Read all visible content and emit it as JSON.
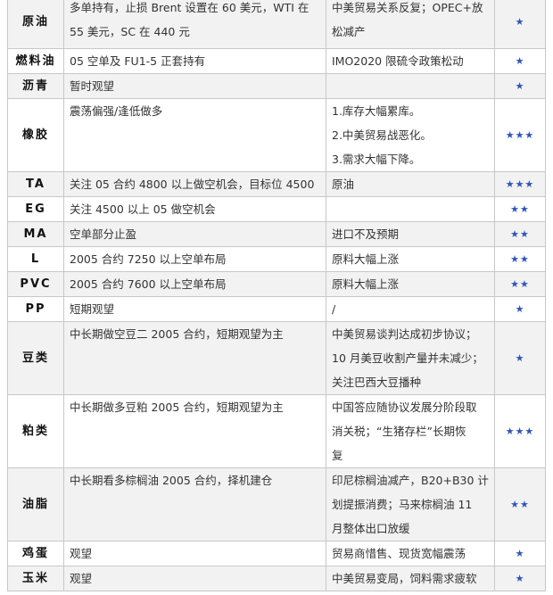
{
  "rows": [
    {
      "name": "原油",
      "strategy": [
        "多单持有，止损 Brent 设置在 60 美元，WTI 在",
        "55 美元，SC 在 440 元"
      ],
      "factors": [
        "中美贸易关系反复；OPEC+放",
        "松减产"
      ],
      "stars": "★",
      "shaded": true
    },
    {
      "name": "燃料油",
      "strategy": [
        "05 空单及 FU1-5 正套持有"
      ],
      "factors": [
        "IMO2020 限硫令政策松动"
      ],
      "stars": "★",
      "shaded": false
    },
    {
      "name": "沥青",
      "strategy": [
        "暂时观望"
      ],
      "factors": [],
      "stars": "★",
      "shaded": true
    },
    {
      "name": "橡胶",
      "strategy": [
        "震荡偏强/逢低做多"
      ],
      "factors": [
        "1.库存大幅累库。",
        "2.中美贸易战恶化。",
        "3.需求大幅下降。"
      ],
      "stars": "★★★",
      "shaded": false
    },
    {
      "name": "TA",
      "strategy": [
        "关注 05 合约 4800 以上做空机会，目标位 4500"
      ],
      "factors": [
        "原油"
      ],
      "stars": "★★★",
      "shaded": true
    },
    {
      "name": "EG",
      "strategy": [
        "关注 4500 以上 05 做空机会"
      ],
      "factors": [],
      "stars": "★★",
      "shaded": false
    },
    {
      "name": "MA",
      "strategy": [
        "空单部分止盈"
      ],
      "factors": [
        "进口不及预期"
      ],
      "stars": "★★",
      "shaded": true
    },
    {
      "name": "L",
      "strategy": [
        "2005 合约 7250 以上空单布局"
      ],
      "factors": [
        "原料大幅上涨"
      ],
      "stars": "★★",
      "shaded": false
    },
    {
      "name": "PVC",
      "strategy": [
        "2005 合约 7600 以上空单布局"
      ],
      "factors": [
        "原料大幅上涨"
      ],
      "stars": "★★",
      "shaded": true
    },
    {
      "name": "PP",
      "strategy": [
        "短期观望"
      ],
      "factors": [
        "/"
      ],
      "stars": "★",
      "shaded": false
    },
    {
      "name": "豆类",
      "strategy": [
        "中长期做空豆二 2005 合约，短期观望为主"
      ],
      "factors": [
        "中美贸易谈判达成初步协议；",
        "10 月美豆收割产量并未减少；",
        "关注巴西大豆播种"
      ],
      "stars": "★",
      "shaded": true
    },
    {
      "name": "粕类",
      "strategy": [
        "中长期做多豆粕 2005 合约，短期观望为主"
      ],
      "factors": [
        "中国答应随协议发展分阶段取",
        "消关税；“生猪存栏”长期恢",
        "复"
      ],
      "stars": "★★★",
      "shaded": false
    },
    {
      "name": "油脂",
      "strategy": [
        "中长期看多棕榈油 2005 合约，择机建仓"
      ],
      "factors": [
        "印尼棕榈油减产，B20+B30 计",
        "划提振消费；马来棕榈油 11",
        "月整体出口放缓"
      ],
      "stars": "★★",
      "shaded": true
    },
    {
      "name": "鸡蛋",
      "strategy": [
        "观望"
      ],
      "factors": [
        "贸易商惜售、现货宽幅震荡"
      ],
      "stars": "★",
      "shaded": false
    },
    {
      "name": "玉米",
      "strategy": [
        "观望"
      ],
      "factors": [
        "中美贸易变局，饲料需求疲软"
      ],
      "stars": "★",
      "shaded": true
    }
  ],
  "colors": {
    "star": "#2f55b8",
    "shade": "#f2f2f2",
    "border": "#c8c8c8"
  }
}
